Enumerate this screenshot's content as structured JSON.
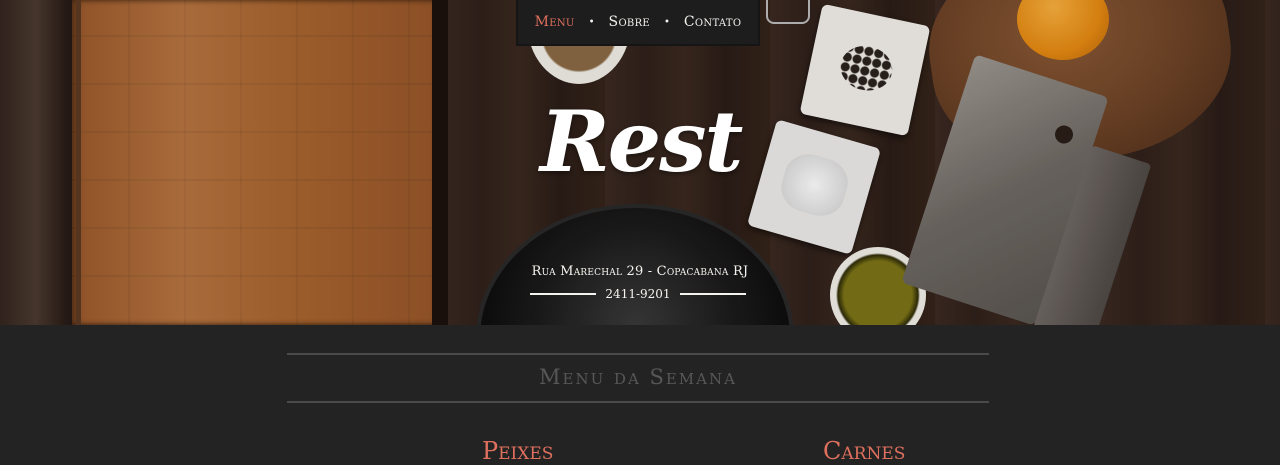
{
  "nav": {
    "items": [
      {
        "label": "Menu",
        "active": true
      },
      {
        "label": "Sobre",
        "active": false
      },
      {
        "label": "Contato",
        "active": false
      }
    ],
    "separator": "•"
  },
  "hero": {
    "logo": "Rest",
    "address": "Rua Marechal 29 - Copacabana RJ",
    "phone": "2411-9201"
  },
  "menu": {
    "title": "Menu da Semana",
    "categories": [
      "Peixes",
      "Carnes"
    ]
  },
  "colors": {
    "accent": "#e0705e",
    "background": "#232323",
    "nav_bg": "#1d1d1d",
    "muted_title": "#575757"
  }
}
